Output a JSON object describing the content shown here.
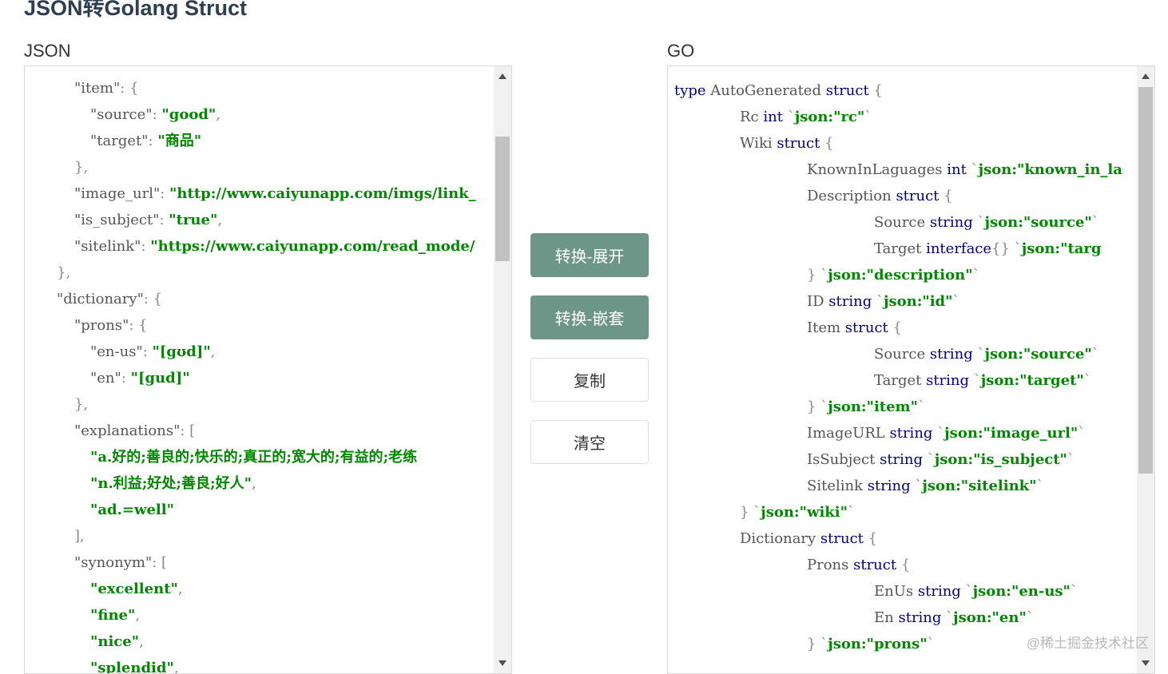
{
  "page": {
    "title": "JSON转Golang Struct"
  },
  "json_pane": {
    "label": "JSON",
    "lines": [
      [
        {
          "t": "\"item\"",
          "c": "key"
        },
        {
          "t": ": {",
          "c": "punc"
        }
      ],
      [
        {
          "t": "\"source\"",
          "c": "key"
        },
        {
          "t": ": ",
          "c": "punc"
        },
        {
          "t": "\"good\"",
          "c": "str"
        },
        {
          "t": ",",
          "c": "punc"
        }
      ],
      [
        {
          "t": "\"target\"",
          "c": "key"
        },
        {
          "t": ": ",
          "c": "punc"
        },
        {
          "t": "\"商品\"",
          "c": "str"
        }
      ],
      [
        {
          "t": "},",
          "c": "punc"
        }
      ],
      [
        {
          "t": "\"image_url\"",
          "c": "key"
        },
        {
          "t": ": ",
          "c": "punc"
        },
        {
          "t": "\"http://www.caiyunapp.com/imgs/link_",
          "c": "str"
        }
      ],
      [
        {
          "t": "\"is_subject\"",
          "c": "key"
        },
        {
          "t": ": ",
          "c": "punc"
        },
        {
          "t": "\"true\"",
          "c": "str"
        },
        {
          "t": ",",
          "c": "punc"
        }
      ],
      [
        {
          "t": "\"sitelink\"",
          "c": "key"
        },
        {
          "t": ": ",
          "c": "punc"
        },
        {
          "t": "\"https://www.caiyunapp.com/read_mode/",
          "c": "str"
        }
      ],
      [
        {
          "t": "},",
          "c": "punc"
        }
      ],
      [
        {
          "t": "\"dictionary\"",
          "c": "key"
        },
        {
          "t": ": {",
          "c": "punc"
        }
      ],
      [
        {
          "t": "\"prons\"",
          "c": "key"
        },
        {
          "t": ": {",
          "c": "punc"
        }
      ],
      [
        {
          "t": "\"en-us\"",
          "c": "key"
        },
        {
          "t": ": ",
          "c": "punc"
        },
        {
          "t": "\"[gʊd]\"",
          "c": "str"
        },
        {
          "t": ",",
          "c": "punc"
        }
      ],
      [
        {
          "t": "\"en\"",
          "c": "key"
        },
        {
          "t": ": ",
          "c": "punc"
        },
        {
          "t": "\"[gud]\"",
          "c": "str"
        }
      ],
      [
        {
          "t": "},",
          "c": "punc"
        }
      ],
      [
        {
          "t": "\"explanations\"",
          "c": "key"
        },
        {
          "t": ": [",
          "c": "punc"
        }
      ],
      [
        {
          "t": "\"a.好的;善良的;快乐的;真正的;宽大的;有益的;老练",
          "c": "str"
        }
      ],
      [
        {
          "t": "\"n.利益;好处;善良;好人\"",
          "c": "str"
        },
        {
          "t": ",",
          "c": "punc"
        }
      ],
      [
        {
          "t": "\"ad.=well\"",
          "c": "str"
        }
      ],
      [
        {
          "t": "],",
          "c": "punc"
        }
      ],
      [
        {
          "t": "\"synonym\"",
          "c": "key"
        },
        {
          "t": ": [",
          "c": "punc"
        }
      ],
      [
        {
          "t": "\"excellent\"",
          "c": "str"
        },
        {
          "t": ",",
          "c": "punc"
        }
      ],
      [
        {
          "t": "\"fine\"",
          "c": "str"
        },
        {
          "t": ",",
          "c": "punc"
        }
      ],
      [
        {
          "t": "\"nice\"",
          "c": "str"
        },
        {
          "t": ",",
          "c": "punc"
        }
      ],
      [
        {
          "t": "\"splendid\"",
          "c": "str"
        },
        {
          "t": ",",
          "c": "punc"
        }
      ]
    ],
    "indents": [
      "ind2",
      "ind3",
      "ind3",
      "ind2",
      "ind2",
      "ind2",
      "ind2",
      "ind1",
      "ind1",
      "ind2",
      "ind3",
      "ind3",
      "ind2",
      "ind2",
      "ind3",
      "ind3",
      "ind3",
      "ind2",
      "ind2",
      "ind3",
      "ind3",
      "ind3",
      "ind3"
    ]
  },
  "go_pane": {
    "label": "GO",
    "lines": [
      [
        {
          "t": "type",
          "c": "kw"
        },
        {
          "t": " AutoGenerated ",
          "c": "key"
        },
        {
          "t": "struct",
          "c": "kw"
        },
        {
          "t": " {",
          "c": "punc"
        }
      ],
      [
        {
          "t": "Rc ",
          "c": "key"
        },
        {
          "t": "int",
          "c": "kw"
        },
        {
          "t": " `",
          "c": "punc"
        },
        {
          "t": "json:\"rc\"",
          "c": "str"
        },
        {
          "t": "`",
          "c": "punc"
        }
      ],
      [
        {
          "t": "Wiki ",
          "c": "key"
        },
        {
          "t": "struct",
          "c": "kw"
        },
        {
          "t": " {",
          "c": "punc"
        }
      ],
      [
        {
          "t": "KnownInLaguages ",
          "c": "key"
        },
        {
          "t": "int",
          "c": "kw"
        },
        {
          "t": " `",
          "c": "punc"
        },
        {
          "t": "json:\"known_in_la",
          "c": "str"
        }
      ],
      [
        {
          "t": "Description ",
          "c": "key"
        },
        {
          "t": "struct",
          "c": "kw"
        },
        {
          "t": " {",
          "c": "punc"
        }
      ],
      [
        {
          "t": "Source ",
          "c": "key"
        },
        {
          "t": "string",
          "c": "kw"
        },
        {
          "t": " `",
          "c": "punc"
        },
        {
          "t": "json:\"source\"",
          "c": "str"
        },
        {
          "t": "`",
          "c": "punc"
        }
      ],
      [
        {
          "t": "Target ",
          "c": "key"
        },
        {
          "t": "interface",
          "c": "kw"
        },
        {
          "t": "{} `",
          "c": "punc"
        },
        {
          "t": "json:\"targ",
          "c": "str"
        }
      ],
      [
        {
          "t": "} `",
          "c": "punc"
        },
        {
          "t": "json:\"description\"",
          "c": "str"
        },
        {
          "t": "`",
          "c": "punc"
        }
      ],
      [
        {
          "t": "ID ",
          "c": "key"
        },
        {
          "t": "string",
          "c": "kw"
        },
        {
          "t": " `",
          "c": "punc"
        },
        {
          "t": "json:\"id\"",
          "c": "str"
        },
        {
          "t": "`",
          "c": "punc"
        }
      ],
      [
        {
          "t": "Item ",
          "c": "key"
        },
        {
          "t": "struct",
          "c": "kw"
        },
        {
          "t": " {",
          "c": "punc"
        }
      ],
      [
        {
          "t": "Source ",
          "c": "key"
        },
        {
          "t": "string",
          "c": "kw"
        },
        {
          "t": " `",
          "c": "punc"
        },
        {
          "t": "json:\"source\"",
          "c": "str"
        },
        {
          "t": "`",
          "c": "punc"
        }
      ],
      [
        {
          "t": "Target ",
          "c": "key"
        },
        {
          "t": "string",
          "c": "kw"
        },
        {
          "t": " `",
          "c": "punc"
        },
        {
          "t": "json:\"target\"",
          "c": "str"
        },
        {
          "t": "`",
          "c": "punc"
        }
      ],
      [
        {
          "t": "} `",
          "c": "punc"
        },
        {
          "t": "json:\"item\"",
          "c": "str"
        },
        {
          "t": "`",
          "c": "punc"
        }
      ],
      [
        {
          "t": "ImageURL ",
          "c": "key"
        },
        {
          "t": "string",
          "c": "kw"
        },
        {
          "t": " `",
          "c": "punc"
        },
        {
          "t": "json:\"image_url\"",
          "c": "str"
        },
        {
          "t": "`",
          "c": "punc"
        }
      ],
      [
        {
          "t": "IsSubject ",
          "c": "key"
        },
        {
          "t": "string",
          "c": "kw"
        },
        {
          "t": " `",
          "c": "punc"
        },
        {
          "t": "json:\"is_subject\"",
          "c": "str"
        },
        {
          "t": "`",
          "c": "punc"
        }
      ],
      [
        {
          "t": "Sitelink ",
          "c": "key"
        },
        {
          "t": "string",
          "c": "kw"
        },
        {
          "t": " `",
          "c": "punc"
        },
        {
          "t": "json:\"sitelink\"",
          "c": "str"
        },
        {
          "t": "`",
          "c": "punc"
        }
      ],
      [
        {
          "t": "} `",
          "c": "punc"
        },
        {
          "t": "json:\"wiki\"",
          "c": "str"
        },
        {
          "t": "`",
          "c": "punc"
        }
      ],
      [
        {
          "t": "Dictionary ",
          "c": "key"
        },
        {
          "t": "struct",
          "c": "kw"
        },
        {
          "t": " {",
          "c": "punc"
        }
      ],
      [
        {
          "t": "Prons ",
          "c": "key"
        },
        {
          "t": "struct",
          "c": "kw"
        },
        {
          "t": " {",
          "c": "punc"
        }
      ],
      [
        {
          "t": "EnUs ",
          "c": "key"
        },
        {
          "t": "string",
          "c": "kw"
        },
        {
          "t": " `",
          "c": "punc"
        },
        {
          "t": "json:\"en-us\"",
          "c": "str"
        },
        {
          "t": "`",
          "c": "punc"
        }
      ],
      [
        {
          "t": "En ",
          "c": "key"
        },
        {
          "t": "string",
          "c": "kw"
        },
        {
          "t": " `",
          "c": "punc"
        },
        {
          "t": "json:\"en\"",
          "c": "str"
        },
        {
          "t": "`",
          "c": "punc"
        }
      ],
      [
        {
          "t": "} `",
          "c": "punc"
        },
        {
          "t": "json:\"prons\"",
          "c": "str"
        },
        {
          "t": "`",
          "c": "punc"
        }
      ]
    ],
    "indents": [
      "",
      "gind1",
      "gind1",
      "gind2",
      "gind2",
      "gind3",
      "gind3",
      "gind2",
      "gind2",
      "gind2",
      "gind3",
      "gind3",
      "gind2",
      "gind2",
      "gind2",
      "gind2",
      "gind1",
      "gind1",
      "gind2",
      "gind3",
      "gind3",
      "gind2"
    ]
  },
  "buttons": {
    "convert_expand": "转换-展开",
    "convert_nested": "转换-嵌套",
    "copy": "复制",
    "clear": "清空"
  },
  "watermark": "@稀土掘金技术社区"
}
